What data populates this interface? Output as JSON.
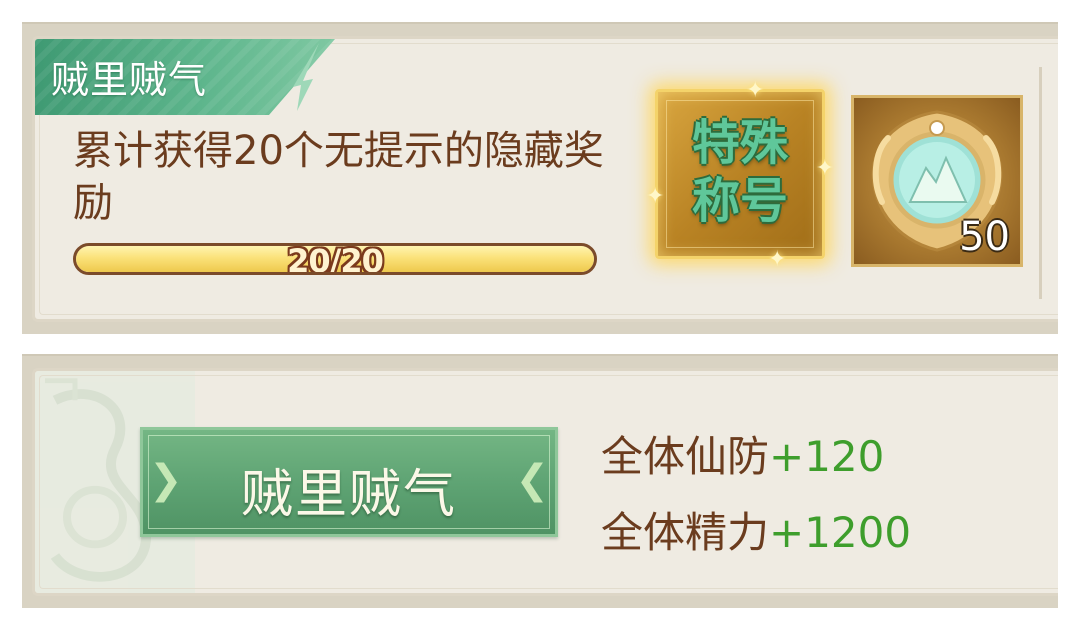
{
  "achievement": {
    "ribbon_title": "贼里贼气",
    "description": "累计获得20个无提示的隐藏奖励",
    "progress": {
      "text": "20/20",
      "fraction": 1.0
    },
    "rewards": {
      "title_label": "特殊\n称号",
      "item_icon": "mountain-orb-icon",
      "item_count": "50"
    }
  },
  "title_preview": {
    "banner_text": "贼里贼气",
    "attributes": [
      {
        "name": "全体仙防",
        "value": "+120"
      },
      {
        "name": "全体精力",
        "value": "+1200"
      }
    ]
  },
  "colors": {
    "brown_text": "#6b3c1e",
    "green_value": "#3e9e2c",
    "ribbon_green": "#4fa57d",
    "gold_glow": "#ffd65a"
  }
}
